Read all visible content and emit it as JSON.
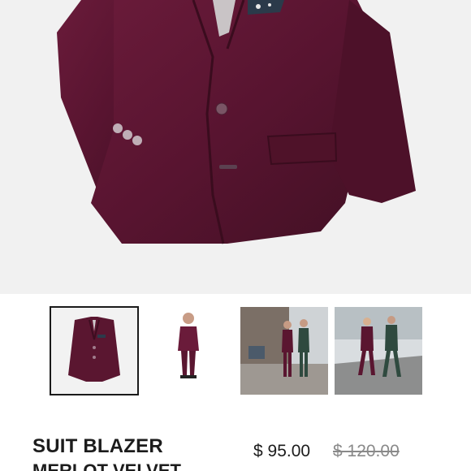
{
  "product": {
    "title": "SUIT BLAZER",
    "subtitle": "MERLOT VELVET",
    "price": "$ 95.00",
    "original_price": "$ 120.00",
    "colors": {
      "velvet": "#5a1630",
      "velvet_dark": "#3f0e22",
      "background": "#f1f1f1",
      "text": "#1c1c1c",
      "strikethrough_text": "#8a8a8a"
    }
  },
  "gallery": {
    "selected_index": 0,
    "thumbnails": [
      {
        "name": "blazer-flatlay"
      },
      {
        "name": "boy-full-outfit"
      },
      {
        "name": "two-boys-street"
      },
      {
        "name": "two-boys-walking"
      }
    ]
  }
}
